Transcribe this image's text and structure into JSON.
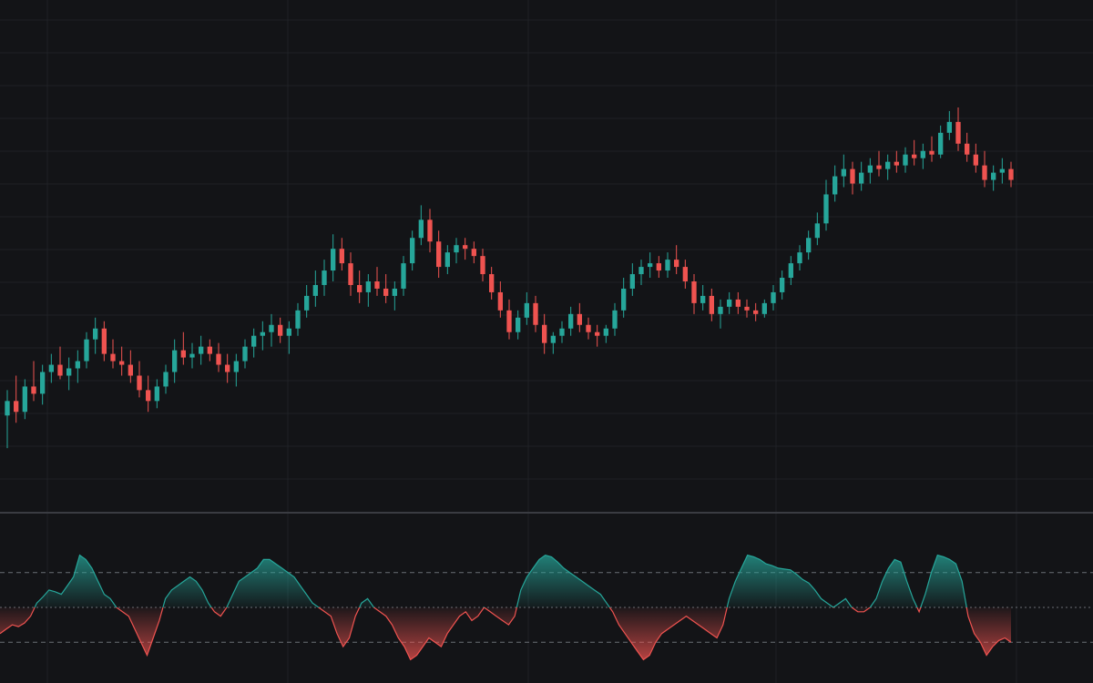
{
  "colors": {
    "background": "#131417",
    "grid": "#1f2126",
    "separator": "#3a3c42",
    "up": "#26a69a",
    "down": "#ef5350",
    "level_line": "#6b6e75"
  },
  "chart_data": [
    {
      "type": "candlestick",
      "title": "",
      "xlabel": "",
      "ylabel": "",
      "grid": true,
      "ylim": [
        0,
        100
      ],
      "candles": [
        {
          "o": 13,
          "h": 20,
          "l": 4,
          "c": 17
        },
        {
          "o": 17,
          "h": 24,
          "l": 11,
          "c": 14
        },
        {
          "o": 14,
          "h": 23,
          "l": 12,
          "c": 21
        },
        {
          "o": 21,
          "h": 28,
          "l": 17,
          "c": 19
        },
        {
          "o": 19,
          "h": 27,
          "l": 16,
          "c": 25
        },
        {
          "o": 25,
          "h": 30,
          "l": 22,
          "c": 27
        },
        {
          "o": 27,
          "h": 32,
          "l": 23,
          "c": 24
        },
        {
          "o": 24,
          "h": 29,
          "l": 20,
          "c": 26
        },
        {
          "o": 26,
          "h": 31,
          "l": 22,
          "c": 28
        },
        {
          "o": 28,
          "h": 36,
          "l": 26,
          "c": 34
        },
        {
          "o": 34,
          "h": 40,
          "l": 30,
          "c": 37
        },
        {
          "o": 37,
          "h": 39,
          "l": 28,
          "c": 30
        },
        {
          "o": 30,
          "h": 34,
          "l": 26,
          "c": 28
        },
        {
          "o": 28,
          "h": 32,
          "l": 24,
          "c": 27
        },
        {
          "o": 27,
          "h": 31,
          "l": 22,
          "c": 24
        },
        {
          "o": 24,
          "h": 28,
          "l": 18,
          "c": 20
        },
        {
          "o": 20,
          "h": 24,
          "l": 14,
          "c": 17
        },
        {
          "o": 17,
          "h": 23,
          "l": 15,
          "c": 21
        },
        {
          "o": 21,
          "h": 27,
          "l": 19,
          "c": 25
        },
        {
          "o": 25,
          "h": 34,
          "l": 22,
          "c": 31
        },
        {
          "o": 31,
          "h": 36,
          "l": 27,
          "c": 29
        },
        {
          "o": 29,
          "h": 33,
          "l": 26,
          "c": 30
        },
        {
          "o": 30,
          "h": 35,
          "l": 27,
          "c": 32
        },
        {
          "o": 32,
          "h": 34,
          "l": 28,
          "c": 30
        },
        {
          "o": 30,
          "h": 33,
          "l": 25,
          "c": 27
        },
        {
          "o": 27,
          "h": 30,
          "l": 22,
          "c": 25
        },
        {
          "o": 25,
          "h": 30,
          "l": 21,
          "c": 28
        },
        {
          "o": 28,
          "h": 34,
          "l": 26,
          "c": 32
        },
        {
          "o": 32,
          "h": 37,
          "l": 29,
          "c": 35
        },
        {
          "o": 35,
          "h": 39,
          "l": 31,
          "c": 36
        },
        {
          "o": 36,
          "h": 41,
          "l": 32,
          "c": 38
        },
        {
          "o": 38,
          "h": 40,
          "l": 33,
          "c": 35
        },
        {
          "o": 35,
          "h": 39,
          "l": 30,
          "c": 37
        },
        {
          "o": 37,
          "h": 44,
          "l": 35,
          "c": 42
        },
        {
          "o": 42,
          "h": 49,
          "l": 40,
          "c": 46
        },
        {
          "o": 46,
          "h": 53,
          "l": 43,
          "c": 49
        },
        {
          "o": 49,
          "h": 56,
          "l": 46,
          "c": 53
        },
        {
          "o": 53,
          "h": 63,
          "l": 50,
          "c": 59
        },
        {
          "o": 59,
          "h": 62,
          "l": 53,
          "c": 55
        },
        {
          "o": 55,
          "h": 58,
          "l": 46,
          "c": 49
        },
        {
          "o": 49,
          "h": 53,
          "l": 44,
          "c": 47
        },
        {
          "o": 47,
          "h": 52,
          "l": 43,
          "c": 50
        },
        {
          "o": 50,
          "h": 54,
          "l": 46,
          "c": 48
        },
        {
          "o": 48,
          "h": 52,
          "l": 44,
          "c": 46
        },
        {
          "o": 46,
          "h": 50,
          "l": 42,
          "c": 48
        },
        {
          "o": 48,
          "h": 57,
          "l": 46,
          "c": 55
        },
        {
          "o": 55,
          "h": 64,
          "l": 53,
          "c": 62
        },
        {
          "o": 62,
          "h": 71,
          "l": 60,
          "c": 67
        },
        {
          "o": 67,
          "h": 70,
          "l": 58,
          "c": 61
        },
        {
          "o": 61,
          "h": 64,
          "l": 51,
          "c": 54
        },
        {
          "o": 54,
          "h": 60,
          "l": 52,
          "c": 58
        },
        {
          "o": 58,
          "h": 62,
          "l": 55,
          "c": 60
        },
        {
          "o": 60,
          "h": 62,
          "l": 56,
          "c": 59
        },
        {
          "o": 59,
          "h": 61,
          "l": 55,
          "c": 57
        },
        {
          "o": 57,
          "h": 59,
          "l": 50,
          "c": 52
        },
        {
          "o": 52,
          "h": 54,
          "l": 45,
          "c": 47
        },
        {
          "o": 47,
          "h": 50,
          "l": 40,
          "c": 42
        },
        {
          "o": 42,
          "h": 45,
          "l": 34,
          "c": 36
        },
        {
          "o": 36,
          "h": 42,
          "l": 34,
          "c": 40
        },
        {
          "o": 40,
          "h": 47,
          "l": 38,
          "c": 44
        },
        {
          "o": 44,
          "h": 46,
          "l": 36,
          "c": 38
        },
        {
          "o": 38,
          "h": 41,
          "l": 30,
          "c": 33
        },
        {
          "o": 33,
          "h": 36,
          "l": 30,
          "c": 35
        },
        {
          "o": 35,
          "h": 39,
          "l": 33,
          "c": 37
        },
        {
          "o": 37,
          "h": 43,
          "l": 35,
          "c": 41
        },
        {
          "o": 41,
          "h": 44,
          "l": 36,
          "c": 38
        },
        {
          "o": 38,
          "h": 40,
          "l": 34,
          "c": 36
        },
        {
          "o": 36,
          "h": 38,
          "l": 32,
          "c": 35
        },
        {
          "o": 35,
          "h": 38,
          "l": 33,
          "c": 37
        },
        {
          "o": 37,
          "h": 44,
          "l": 35,
          "c": 42
        },
        {
          "o": 42,
          "h": 51,
          "l": 40,
          "c": 48
        },
        {
          "o": 48,
          "h": 55,
          "l": 46,
          "c": 52
        },
        {
          "o": 52,
          "h": 56,
          "l": 49,
          "c": 54
        },
        {
          "o": 54,
          "h": 58,
          "l": 51,
          "c": 55
        },
        {
          "o": 55,
          "h": 57,
          "l": 51,
          "c": 53
        },
        {
          "o": 53,
          "h": 58,
          "l": 51,
          "c": 56
        },
        {
          "o": 56,
          "h": 60,
          "l": 52,
          "c": 54
        },
        {
          "o": 54,
          "h": 56,
          "l": 48,
          "c": 50
        },
        {
          "o": 50,
          "h": 52,
          "l": 41,
          "c": 44
        },
        {
          "o": 44,
          "h": 49,
          "l": 42,
          "c": 46
        },
        {
          "o": 46,
          "h": 48,
          "l": 39,
          "c": 41
        },
        {
          "o": 41,
          "h": 45,
          "l": 37,
          "c": 43
        },
        {
          "o": 43,
          "h": 47,
          "l": 41,
          "c": 45
        },
        {
          "o": 45,
          "h": 47,
          "l": 41,
          "c": 43
        },
        {
          "o": 43,
          "h": 45,
          "l": 40,
          "c": 42
        },
        {
          "o": 42,
          "h": 44,
          "l": 39,
          "c": 41
        },
        {
          "o": 41,
          "h": 45,
          "l": 40,
          "c": 44
        },
        {
          "o": 44,
          "h": 49,
          "l": 42,
          "c": 47
        },
        {
          "o": 47,
          "h": 53,
          "l": 45,
          "c": 51
        },
        {
          "o": 51,
          "h": 57,
          "l": 49,
          "c": 55
        },
        {
          "o": 55,
          "h": 60,
          "l": 53,
          "c": 58
        },
        {
          "o": 58,
          "h": 64,
          "l": 56,
          "c": 62
        },
        {
          "o": 62,
          "h": 69,
          "l": 60,
          "c": 66
        },
        {
          "o": 66,
          "h": 78,
          "l": 64,
          "c": 74
        },
        {
          "o": 74,
          "h": 82,
          "l": 72,
          "c": 79
        },
        {
          "o": 79,
          "h": 85,
          "l": 76,
          "c": 81
        },
        {
          "o": 81,
          "h": 83,
          "l": 74,
          "c": 77
        },
        {
          "o": 77,
          "h": 83,
          "l": 75,
          "c": 80
        },
        {
          "o": 80,
          "h": 84,
          "l": 77,
          "c": 82
        },
        {
          "o": 82,
          "h": 86,
          "l": 79,
          "c": 81
        },
        {
          "o": 81,
          "h": 85,
          "l": 78,
          "c": 83
        },
        {
          "o": 83,
          "h": 86,
          "l": 80,
          "c": 82
        },
        {
          "o": 82,
          "h": 87,
          "l": 80,
          "c": 85
        },
        {
          "o": 85,
          "h": 89,
          "l": 82,
          "c": 84
        },
        {
          "o": 84,
          "h": 88,
          "l": 81,
          "c": 86
        },
        {
          "o": 86,
          "h": 90,
          "l": 83,
          "c": 85
        },
        {
          "o": 85,
          "h": 93,
          "l": 84,
          "c": 91
        },
        {
          "o": 91,
          "h": 97,
          "l": 89,
          "c": 94
        },
        {
          "o": 94,
          "h": 98,
          "l": 86,
          "c": 88
        },
        {
          "o": 88,
          "h": 91,
          "l": 83,
          "c": 85
        },
        {
          "o": 85,
          "h": 88,
          "l": 80,
          "c": 82
        },
        {
          "o": 82,
          "h": 86,
          "l": 76,
          "c": 78
        },
        {
          "o": 78,
          "h": 82,
          "l": 75,
          "c": 80
        },
        {
          "o": 80,
          "h": 84,
          "l": 77,
          "c": 81
        },
        {
          "o": 81,
          "h": 83,
          "l": 76,
          "c": 78
        }
      ]
    },
    {
      "type": "area",
      "title": "",
      "xlabel": "",
      "ylabel": "",
      "grid": false,
      "ylim": [
        -70,
        70
      ],
      "baseline": 0,
      "reference_levels": [
        40,
        0,
        -40
      ],
      "values": [
        -30,
        -25,
        -20,
        -22,
        -18,
        -10,
        5,
        12,
        20,
        18,
        15,
        25,
        35,
        60,
        55,
        45,
        30,
        15,
        10,
        0,
        -5,
        -10,
        -25,
        -40,
        -55,
        -35,
        -15,
        10,
        20,
        25,
        30,
        35,
        30,
        20,
        5,
        -5,
        -10,
        0,
        15,
        30,
        35,
        40,
        45,
        55,
        55,
        50,
        45,
        40,
        35,
        25,
        15,
        5,
        0,
        -5,
        -10,
        -30,
        -45,
        -35,
        -10,
        5,
        10,
        0,
        -5,
        -10,
        -20,
        -35,
        -45,
        -60,
        -55,
        -45,
        -35,
        -40,
        -45,
        -30,
        -20,
        -10,
        -5,
        -15,
        -10,
        0,
        -5,
        -10,
        -15,
        -20,
        -10,
        20,
        35,
        45,
        55,
        60,
        58,
        52,
        45,
        40,
        35,
        30,
        25,
        20,
        15,
        5,
        -5,
        -20,
        -30,
        -40,
        -50,
        -60,
        -55,
        -40,
        -30,
        -25,
        -20,
        -15,
        -10,
        -15,
        -20,
        -25,
        -30,
        -35,
        -20,
        10,
        30,
        45,
        60,
        58,
        55,
        50,
        48,
        45,
        44,
        43,
        38,
        32,
        28,
        20,
        10,
        5,
        0,
        5,
        10,
        0,
        -5,
        -5,
        0,
        10,
        30,
        45,
        55,
        52,
        30,
        10,
        -5,
        15,
        40,
        60,
        58,
        55,
        50,
        30,
        -10,
        -30,
        -40,
        -55,
        -45,
        -38,
        -35,
        -40
      ]
    }
  ]
}
